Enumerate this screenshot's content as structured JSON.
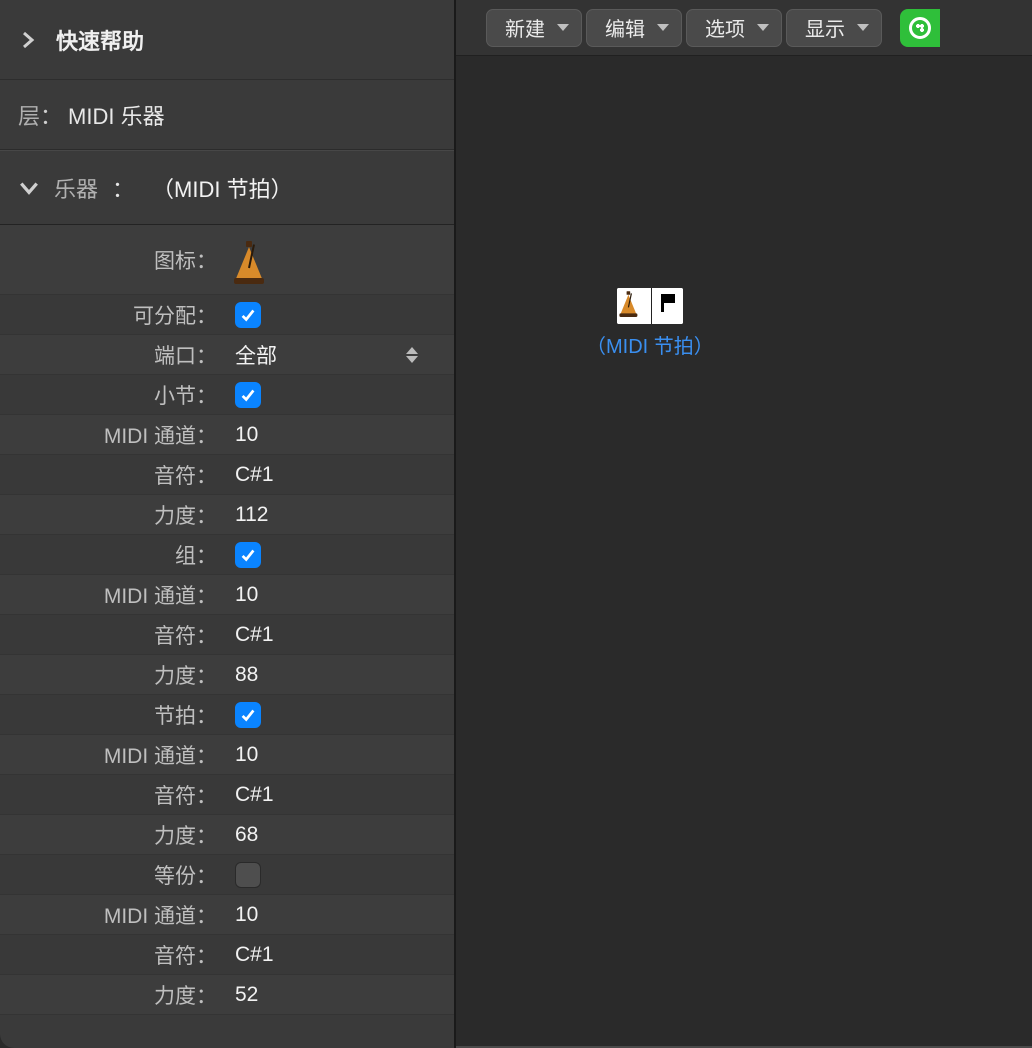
{
  "sidebar": {
    "quick_help": "快速帮助",
    "layer_label": "层",
    "layer_value": "MIDI 乐器",
    "instrument_label": "乐器",
    "instrument_value": "（MIDI 节拍）"
  },
  "rows": {
    "icon": "图标",
    "assignable": "可分配",
    "port_label": "端口",
    "port_value": "全部",
    "bar": "小节",
    "midi_ch_1": "MIDI 通道",
    "midi_ch_1_v": "10",
    "note_1": "音符",
    "note_1_v": "C#1",
    "vel_1": "力度",
    "vel_1_v": "112",
    "group": "组",
    "midi_ch_2": "MIDI 通道",
    "midi_ch_2_v": "10",
    "note_2": "音符",
    "note_2_v": "C#1",
    "vel_2": "力度",
    "vel_2_v": "88",
    "beat": "节拍",
    "midi_ch_3": "MIDI 通道",
    "midi_ch_3_v": "10",
    "note_3": "音符",
    "note_3_v": "C#1",
    "vel_3": "力度",
    "vel_3_v": "68",
    "division": "等份",
    "midi_ch_4": "MIDI 通道",
    "midi_ch_4_v": "10",
    "note_4": "音符",
    "note_4_v": "C#1",
    "vel_4": "力度",
    "vel_4_v": "52"
  },
  "toolbar": {
    "new": "新建",
    "edit": "编辑",
    "options": "选项",
    "view": "显示"
  },
  "canvas": {
    "node_caption": "（MIDI 节拍）"
  }
}
